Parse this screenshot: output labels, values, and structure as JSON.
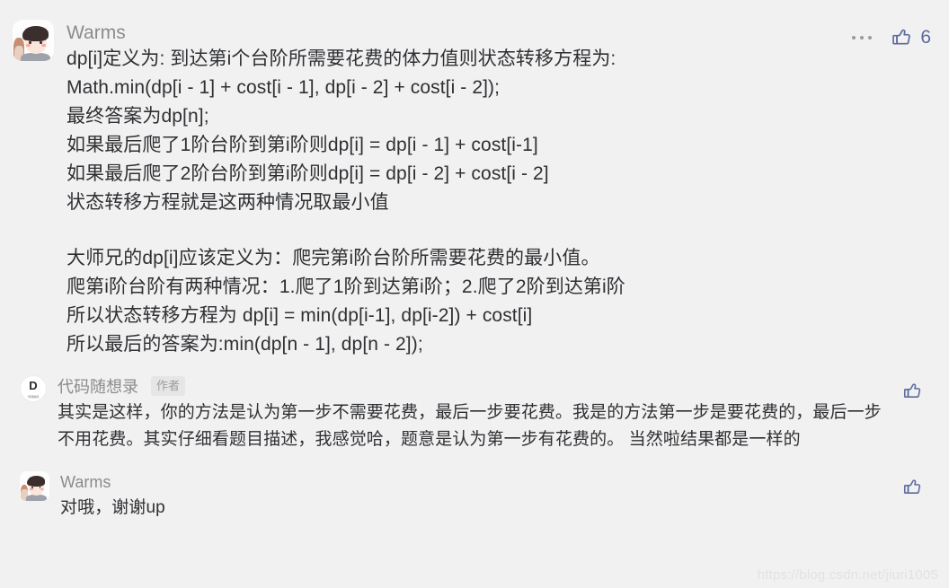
{
  "colors": {
    "background": "#f1f1f1",
    "text": "#2f3033",
    "username": "#8b8b8b",
    "accent": "#5b6b9e",
    "badge_bg": "#e6e6e6",
    "badge_text": "#9b9b9b",
    "watermark": "#e2e2e2"
  },
  "comment": {
    "avatar_name": "warms-avatar",
    "username": "Warms",
    "more_icon": "more-horizontal-icon",
    "like_icon": "thumbs-up-icon",
    "like_count": "6",
    "paragraph_1": "dp[i]定义为: 到达第i个台阶所需要花费的体力值则状态转移方程为:\nMath.min(dp[i - 1] + cost[i - 1], dp[i - 2] + cost[i - 2]);\n最终答案为dp[n];\n如果最后爬了1阶台阶到第i阶则dp[i] = dp[i - 1] + cost[i-1]\n如果最后爬了2阶台阶到第i阶则dp[i] = dp[i - 2] + cost[i - 2]\n状态转移方程就是这两种情况取最小值",
    "paragraph_2": "大师兄的dp[i]应该定义为：爬完第i阶台阶所需要花费的最小值。\n爬第i阶台阶有两种情况：1.爬了1阶到达第i阶；2.爬了2阶到达第i阶\n所以状态转移方程为 dp[i] = min(dp[i-1], dp[i-2]) + cost[i]\n所以最后的答案为:min(dp[n - 1], dp[n - 2]);"
  },
  "replies": [
    {
      "avatar_name": "daimasuixianglu-logo-avatar",
      "avatar_letter": "D",
      "avatar_caption": "代码随想录",
      "username": "代码随想录",
      "badge": "作者",
      "like_icon": "thumbs-up-icon",
      "text": "其实是这样，你的方法是认为第一步不需要花费，最后一步要花费。我是的方法第一步是要花费的，最后一步不用花费。其实仔细看题目描述，我感觉哈，题意是认为第一步有花费的。 当然啦结果都是一样的"
    },
    {
      "avatar_name": "warms-avatar",
      "username": "Warms",
      "badge": "",
      "like_icon": "thumbs-up-icon",
      "text": "对哦，谢谢up"
    }
  ],
  "watermark": "https://blog.csdn.net/jiuri1005"
}
